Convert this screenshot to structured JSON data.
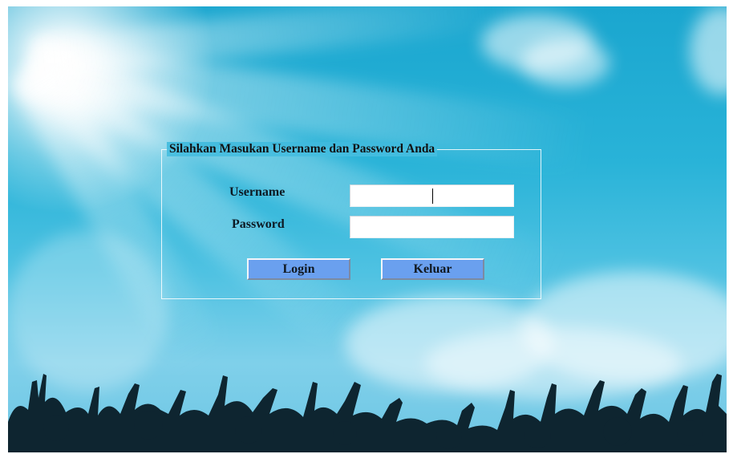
{
  "login_form": {
    "legend": "Silahkan Masukan Username dan Password Anda",
    "username_label": "Username",
    "username_value": "",
    "password_label": "Password",
    "password_value": "",
    "login_label": "Login",
    "exit_label": "Keluar"
  },
  "colors": {
    "sky": "#29b3d8",
    "button": "#6aa0ef",
    "silhouette": "#0e2530"
  }
}
